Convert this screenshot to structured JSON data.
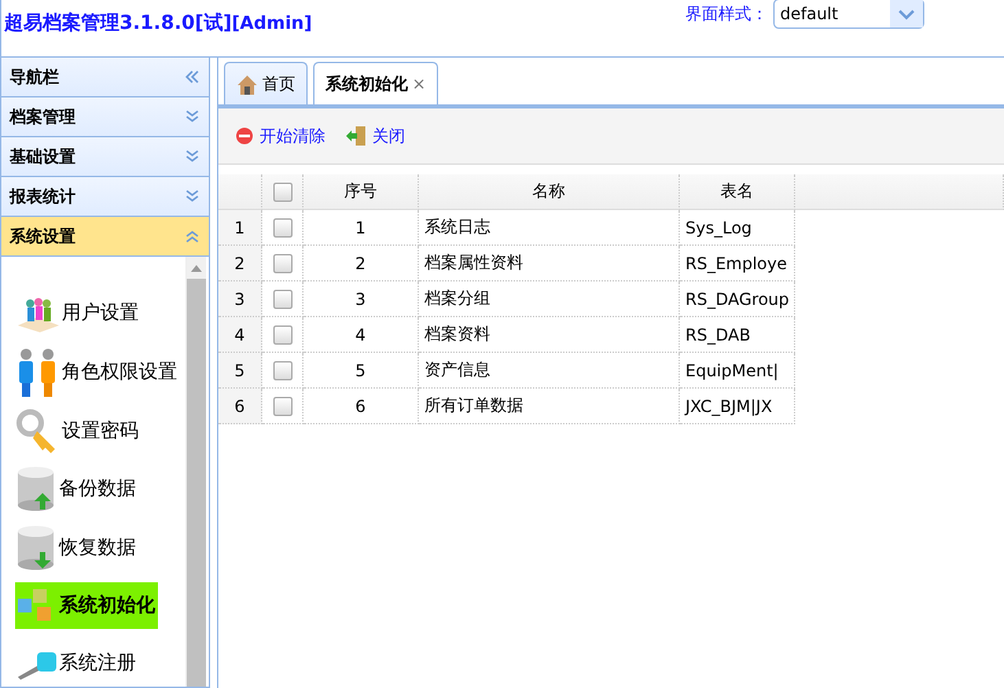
{
  "header": {
    "title": "超易档案管理3.1.8.0[试]",
    "user": "[Admin]",
    "style_label": "界面样式：",
    "style_value": "default"
  },
  "sidebar": {
    "title": "导航栏",
    "sections": [
      {
        "label": "档案管理",
        "expanded": false
      },
      {
        "label": "基础设置",
        "expanded": false
      },
      {
        "label": "报表统计",
        "expanded": false
      },
      {
        "label": "系统设置",
        "expanded": true
      }
    ],
    "items": [
      {
        "label": "用户设置",
        "selected": false
      },
      {
        "label": "角色权限设置",
        "selected": false
      },
      {
        "label": "设置密码",
        "selected": false
      },
      {
        "label": "备份数据",
        "selected": false
      },
      {
        "label": "恢复数据",
        "selected": false
      },
      {
        "label": "系统初始化",
        "selected": true
      },
      {
        "label": "系统注册",
        "selected": false
      }
    ]
  },
  "tabs": [
    {
      "label": "首页",
      "selected": false,
      "closable": false
    },
    {
      "label": "系统初始化",
      "selected": true,
      "closable": true
    }
  ],
  "close_glyph": "×",
  "toolbar": [
    {
      "label": "开始清除"
    },
    {
      "label": "关闭"
    }
  ],
  "table": {
    "select_all_checked": false,
    "columns": [
      "序号",
      "名称",
      "表名"
    ],
    "rows": [
      {
        "row_number": "1",
        "checked": false,
        "cells": [
          "1",
          "系统日志",
          "Sys_Log"
        ]
      },
      {
        "row_number": "2",
        "checked": false,
        "cells": [
          "2",
          "档案属性资料",
          "RS_Employe"
        ]
      },
      {
        "row_number": "3",
        "checked": false,
        "cells": [
          "3",
          "档案分组",
          "RS_DAGroup"
        ]
      },
      {
        "row_number": "4",
        "checked": false,
        "cells": [
          "4",
          "档案资料",
          "RS_DAB"
        ]
      },
      {
        "row_number": "5",
        "checked": false,
        "cells": [
          "5",
          "资产信息",
          "EquipMent|"
        ]
      },
      {
        "row_number": "6",
        "checked": false,
        "cells": [
          "6",
          "所有订单数据",
          "JXC_BJM|JX"
        ]
      }
    ]
  }
}
